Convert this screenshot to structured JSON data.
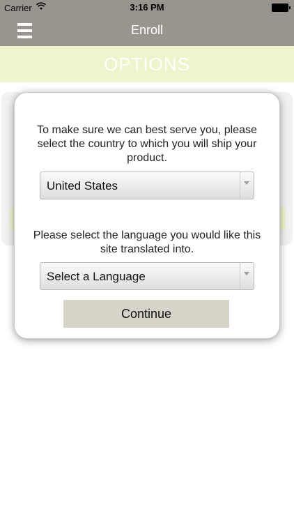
{
  "status_bar": {
    "carrier": "Carrier",
    "time": "3:16 PM"
  },
  "nav": {
    "title": "Enroll",
    "menu_icon": "hamburger-menu-icon"
  },
  "options_title": "OPTIONS",
  "modal": {
    "country_prompt": "To make sure we can best serve you, please select the country to which you will ship your product.",
    "country_select_value": "United States",
    "language_prompt": "Please select the language you would like this site translated into.",
    "language_select_value": "Select a Language",
    "continue_label": "Continue"
  },
  "colors": {
    "nav_background": "#9a948e",
    "options_band": "#f0f4cc",
    "continue_button": "#d6d4c8"
  }
}
